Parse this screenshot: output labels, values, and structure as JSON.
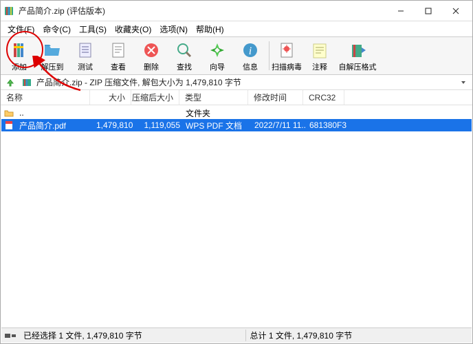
{
  "window": {
    "title": "产品简介.zip (评估版本)"
  },
  "menu": {
    "file": "文件(F)",
    "commands": "命令(C)",
    "tools": "工具(S)",
    "favorites": "收藏夹(O)",
    "options": "选项(N)",
    "help": "帮助(H)"
  },
  "toolbar": {
    "add": "添加",
    "extract_to": "解压到",
    "test": "测试",
    "view": "查看",
    "delete": "删除",
    "find": "查找",
    "wizard": "向导",
    "info": "信息",
    "virus_scan": "扫描病毒",
    "comment": "注释",
    "sfx": "自解压格式"
  },
  "address": {
    "text": "产品简介.zip - ZIP 压缩文件, 解包大小为 1,479,810 字节"
  },
  "columns": {
    "name": "名称",
    "size": "大小",
    "packed": "压缩后大小",
    "type": "类型",
    "mtime": "修改时间",
    "crc": "CRC32"
  },
  "rows": {
    "parent_folder_type": "文件夹",
    "file1": {
      "name": "产品简介.pdf",
      "size": "1,479,810",
      "packed": "1,119,055",
      "type": "WPS PDF 文档",
      "mtime": "2022/7/11 11...",
      "crc": "681380F3"
    }
  },
  "status": {
    "selected": "已经选择 1 文件, 1,479,810 字节",
    "total": "总计 1 文件, 1,479,810 字节"
  }
}
